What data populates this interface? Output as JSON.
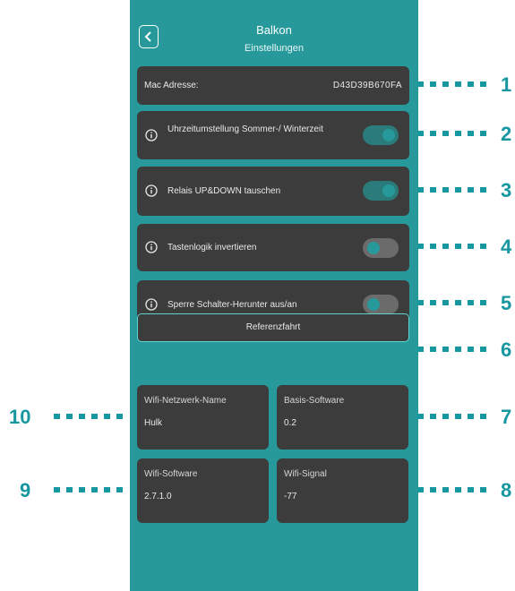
{
  "header": {
    "title": "Balkon",
    "subtitle": "Einstellungen"
  },
  "mac": {
    "label": "Mac Adresse:",
    "value": "D43D39B670FA"
  },
  "settings": [
    {
      "label": "Uhrzeitumstellung Sommer-/ Winterzeit",
      "on": true
    },
    {
      "label": "Relais UP&DOWN tauschen",
      "on": true
    },
    {
      "label": "Tastenlogik invertieren",
      "on": false
    },
    {
      "label": "Sperre Schalter-Herunter aus/an",
      "on": false
    }
  ],
  "reference_button": {
    "label": "Referenzfahrt"
  },
  "info": [
    {
      "label": "Wifi-Netzwerk-Name",
      "value": "Hulk"
    },
    {
      "label": "Basis-Software",
      "value": "0.2"
    },
    {
      "label": "Wifi-Software",
      "value": "2.7.1.0"
    },
    {
      "label": "Wifi-Signal",
      "value": "-77"
    }
  ],
  "callouts": [
    "1",
    "2",
    "3",
    "4",
    "5",
    "6",
    "7",
    "8",
    "9",
    "10"
  ],
  "colors": {
    "background": "#27999b",
    "card": "#3c3c3c",
    "toggle_on": "#2a7b79",
    "toggle_off": "#6b6b6b",
    "accent": "#1797a0"
  },
  "icons": {
    "back": "chevron-left-icon",
    "info": "info-circle-icon"
  }
}
